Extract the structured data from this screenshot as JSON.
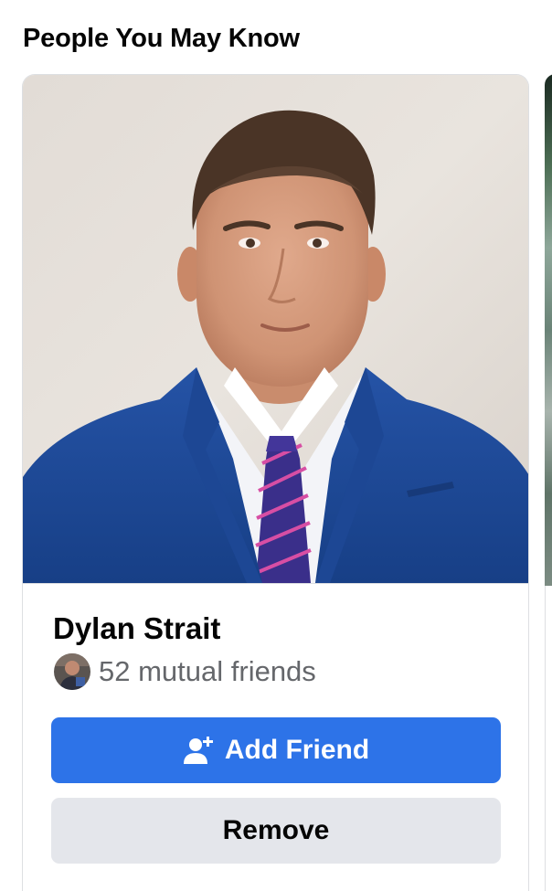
{
  "section": {
    "title": "People You May Know"
  },
  "suggestion": {
    "name": "Dylan Strait",
    "mutual_friends_text": "52 mutual friends",
    "add_friend_label": "Add Friend",
    "remove_label": "Remove"
  },
  "icons": {
    "add_friend": "person-add-icon",
    "mutual_avatar": "mutual-friend-avatar"
  },
  "colors": {
    "primary_button": "#2d73e8",
    "secondary_button": "#e4e6eb",
    "secondary_text": "#65676b",
    "card_border": "#dddfe2"
  }
}
